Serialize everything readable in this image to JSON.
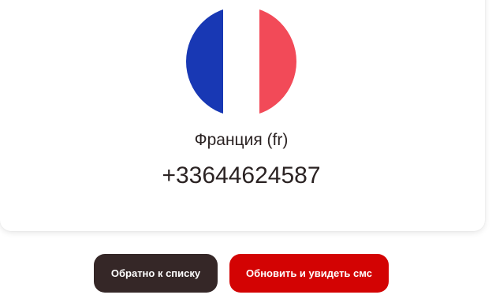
{
  "country": {
    "name": "Франция (fr)",
    "flag_icon": "france-flag-icon",
    "flag_colors": [
      "#1838b4",
      "#ffffff",
      "#f24a58"
    ]
  },
  "phone_number": "+33644624587",
  "buttons": {
    "back_label": "Обратно к списку",
    "refresh_label": "Обновить и увидеть смс"
  },
  "colors": {
    "back_button": "#352727",
    "refresh_button": "#d30303",
    "text": "#2b2323"
  }
}
